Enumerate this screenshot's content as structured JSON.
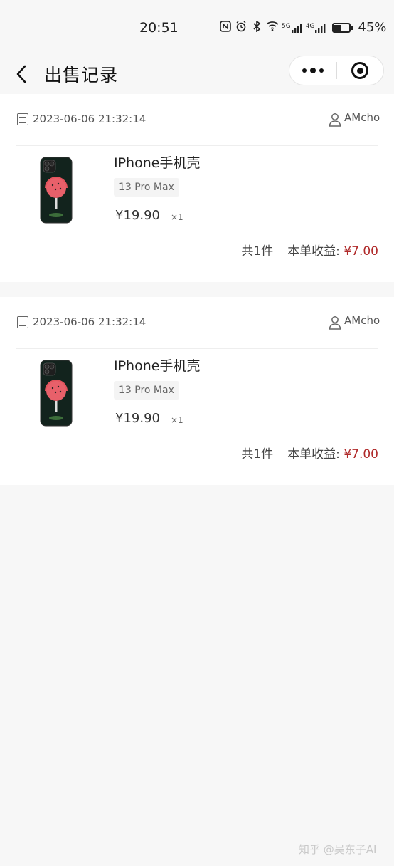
{
  "status_bar": {
    "time": "20:51",
    "icons": [
      "nfc-icon",
      "alarm-icon",
      "bluetooth-icon",
      "wifi-icon",
      "5g-signal-icon",
      "4g-signal-icon",
      "battery-icon"
    ],
    "signal_5g": "5G",
    "signal_4g": "4G",
    "battery_percent": "45%",
    "battery_level": 0.45
  },
  "nav": {
    "title": "出售记录"
  },
  "orders": [
    {
      "date": "2023-06-06 21:32:14",
      "user": "AMcho",
      "product_name": "IPhone手机壳",
      "sku": "13 Pro Max",
      "price": "¥19.90",
      "qty": "×1",
      "count_text": "共1件",
      "earn_label": "本单收益:",
      "earn_value": "¥7.00"
    },
    {
      "date": "2023-06-06 21:32:14",
      "user": "AMcho",
      "product_name": "IPhone手机壳",
      "sku": "13 Pro Max",
      "price": "¥19.90",
      "qty": "×1",
      "count_text": "共1件",
      "earn_label": "本单收益:",
      "earn_value": "¥7.00"
    }
  ],
  "watermark": "知乎 @吴东子AI",
  "colors": {
    "background": "#f7f7f7",
    "card": "#ffffff",
    "earn": "#b02a2a"
  }
}
